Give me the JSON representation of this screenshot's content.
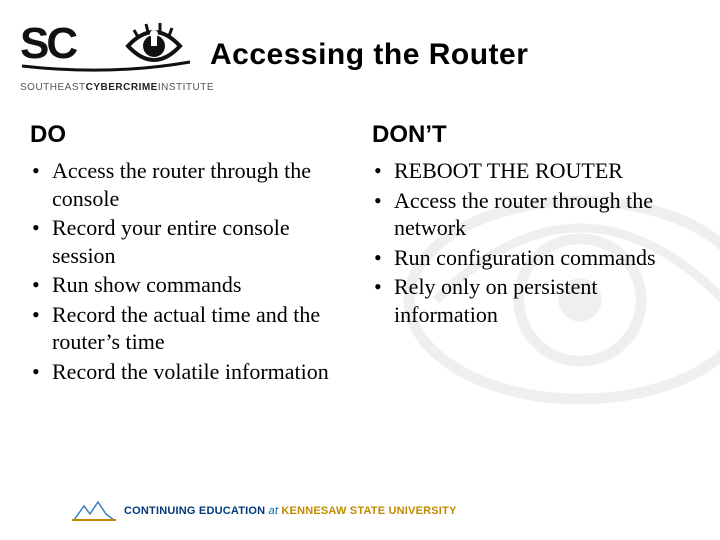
{
  "header": {
    "title": "Accessing the Router",
    "logo_text_prefix": "SOUTHEAST",
    "logo_text_bold": "CYBERCRIME",
    "logo_text_suffix": "INSTITUTE",
    "logo_name": "sci-eye-logo"
  },
  "columns": {
    "do": {
      "heading": "DO",
      "items": [
        "Access the router through the console",
        "Record your entire console session",
        "Run show commands",
        "Record the actual time and the router’s time",
        "Record the volatile information"
      ]
    },
    "dont": {
      "heading": "DON’T",
      "items": [
        "REBOOT THE ROUTER",
        "Access the router through the network",
        "Run configuration commands",
        "Rely only on persistent information"
      ]
    }
  },
  "footer": {
    "ce_bold": "CONTINUING EDUCATION",
    "ce_italic": " at ",
    "ksu": "KENNESAW STATE UNIVERSITY"
  }
}
